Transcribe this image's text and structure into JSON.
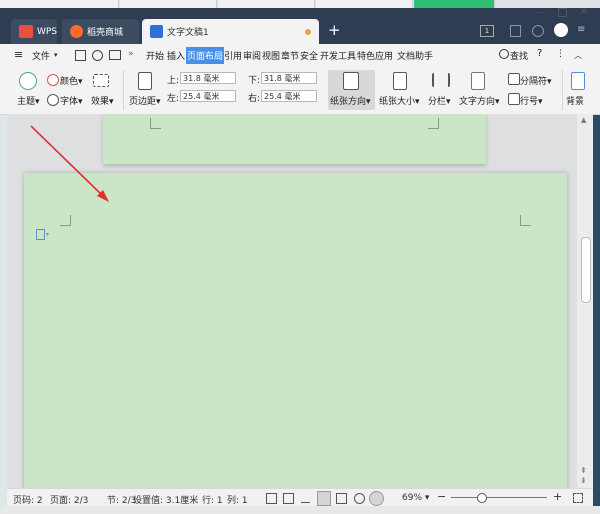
{
  "tabs": {
    "wps": "WPS",
    "shop": "稻壳商城",
    "doc": "文字文稿1",
    "add": "+"
  },
  "menubar": {
    "file": "文件",
    "items": [
      "开始",
      "插入",
      "页面布局",
      "引用",
      "审阅",
      "视图",
      "章节",
      "安全",
      "开发工具",
      "特色应用",
      "文档助手"
    ],
    "active": "页面布局",
    "search": "查找",
    "help": "?"
  },
  "ribbon": {
    "theme": "主题",
    "colors": "颜色",
    "fonts": "字体",
    "effects": "效果",
    "margins": "页边距",
    "top_label": "上:",
    "top_value": "31.8 毫米",
    "bottom_label": "下:",
    "bottom_value": "31.8 毫米",
    "left_label": "左:",
    "left_value": "25.4 毫米",
    "right_label": "右:",
    "right_value": "25.4 毫米",
    "orientation": "纸张方向",
    "size": "纸张大小",
    "columns": "分栏",
    "text_direction": "文字方向",
    "breaks": "分隔符",
    "line_numbers": "行号",
    "background": "背景"
  },
  "statusbar": {
    "pages": "页码: 2",
    "page_of": "页面: 2/3",
    "section": "节: 2/3",
    "setting": "设置值: 3.1厘米",
    "row": "行: 1",
    "col": "列: 1",
    "zoom": "69%",
    "minus": "−",
    "plus": "+"
  },
  "colors": {
    "accent": "#4a8fe7",
    "page_green": "#cbe6c7",
    "titlebar": "#2f3d52",
    "arrow": "#e0302a"
  }
}
